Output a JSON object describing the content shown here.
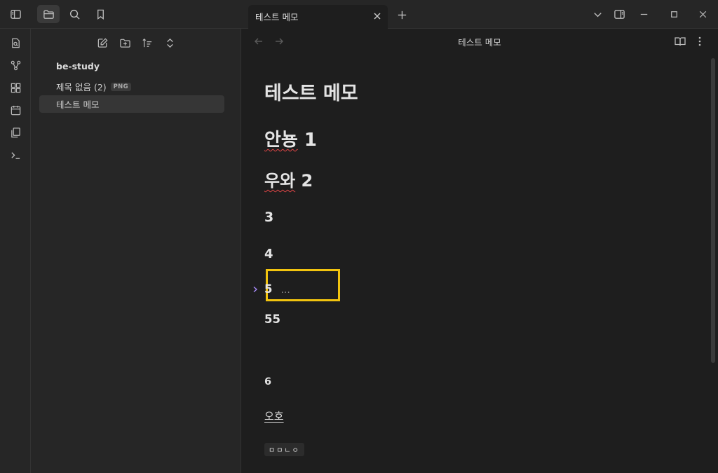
{
  "titlebar": {
    "tab": {
      "title": "테스트 메모"
    },
    "icons": [
      "sidebar-toggle-icon",
      "folder-icon",
      "search-icon",
      "bookmark-icon",
      "plus-icon",
      "chevron-down-icon",
      "right-sidebar-icon",
      "minimize-icon",
      "maximize-icon",
      "close-icon"
    ]
  },
  "ribbon": {
    "icons": [
      "quick-switcher-icon",
      "graph-view-icon",
      "canvas-icon",
      "daily-note-icon",
      "templates-icon",
      "command-palette-icon"
    ]
  },
  "sidebar": {
    "toolbar_icons": [
      "new-note-icon",
      "new-folder-icon",
      "sort-icon",
      "collapse-all-icon"
    ],
    "tree": {
      "folder": "be-study",
      "items": [
        {
          "label": "제목 없음 (2)",
          "badge": "PNG"
        },
        {
          "label": "테스트 메모",
          "active": true
        }
      ]
    }
  },
  "view": {
    "title": "테스트 메모",
    "icons": [
      "back-arrow-icon",
      "forward-arrow-icon",
      "reading-view-icon",
      "more-options-icon"
    ]
  },
  "note": {
    "h1": "테스트 메모",
    "h2a_word": "안뇽",
    "h2a_num": "1",
    "h2b_word": "우와",
    "h2b_num": "2",
    "h3": "3",
    "h4": "4",
    "h5": "5",
    "h5_ellipsis": "...",
    "h5b": "55",
    "h6": "6",
    "link": "오호",
    "code": "ㅁㅁㄴㅇ"
  },
  "colors": {
    "accent": "#a78bfa",
    "highlight": "#f2c40f",
    "spellcheck": "#e04545"
  }
}
